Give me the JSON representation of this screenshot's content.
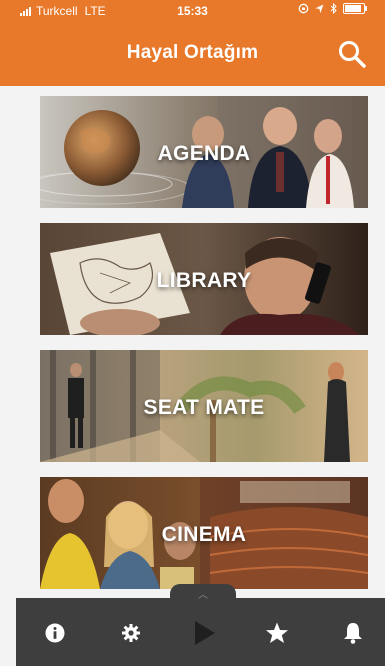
{
  "status_bar": {
    "carrier": "Turkcell",
    "network": "LTE",
    "time": "15:33",
    "battery_level": 0.9
  },
  "header": {
    "title": "Hayal Ortağım",
    "search_icon": "search-icon"
  },
  "cards": [
    {
      "label": "AGENDA"
    },
    {
      "label": "LIBRARY"
    },
    {
      "label": "SEAT MATE"
    },
    {
      "label": "CINEMA"
    }
  ],
  "bottom_bar": {
    "handle_icon": "chevron-up-icon",
    "items": [
      {
        "icon": "info-icon"
      },
      {
        "icon": "gear-icon"
      },
      {
        "icon": "play-icon"
      },
      {
        "icon": "star-icon"
      },
      {
        "icon": "bell-icon"
      }
    ]
  },
  "colors": {
    "brand_orange": "#e8792a",
    "bottom_bar": "#3e3e3e",
    "background": "#f3f3f3"
  }
}
